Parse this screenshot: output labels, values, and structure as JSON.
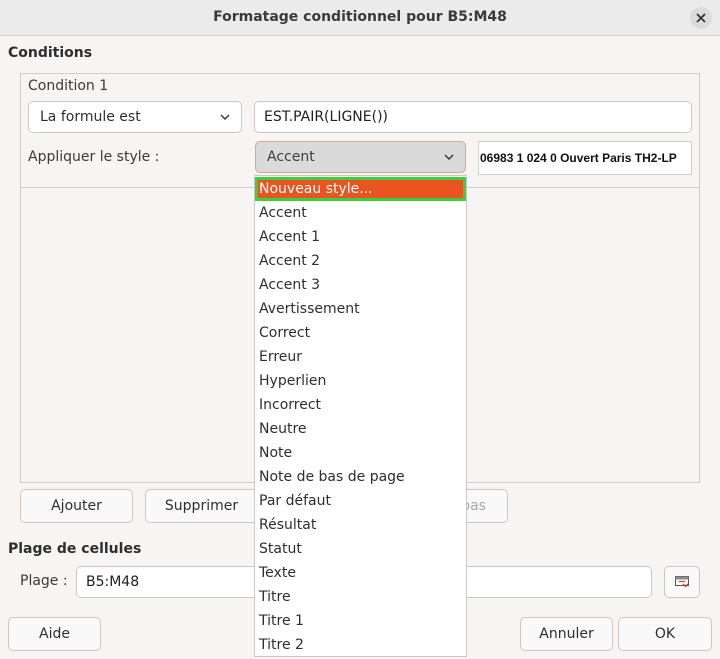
{
  "window": {
    "title": "Formatage conditionnel pour B5:M48"
  },
  "conditions": {
    "section_label": "Conditions",
    "condition_label": "Condition 1",
    "type_combo": {
      "value": "La formule est"
    },
    "formula_entry": {
      "value": "EST.PAIR(LIGNE())"
    },
    "apply_style_label": "Appliquer le style :",
    "style_combo": {
      "value": "Accent"
    },
    "preview_text": "06983 1 024 0  Ouvert Paris TH2-LP"
  },
  "style_dropdown": {
    "items": [
      "Nouveau style...",
      "Accent",
      "Accent 1",
      "Accent 2",
      "Accent 3",
      "Avertissement",
      "Correct",
      "Erreur",
      "Hyperlien",
      "Incorrect",
      "Neutre",
      "Note",
      "Note de bas de page",
      "Par défaut",
      "Résultat",
      "Statut",
      "Texte",
      "Titre",
      "Titre 1",
      "Titre 2"
    ],
    "selected_index": 0
  },
  "buttons": {
    "add": "Ajouter",
    "delete": "Supprimer",
    "down_partial": "bas",
    "help": "Aide",
    "cancel": "Annuler",
    "ok": "OK"
  },
  "range": {
    "section_label": "Plage de cellules",
    "label": "Plage :",
    "value": "B5:M48"
  },
  "colors": {
    "selection": "#e95420",
    "selection_outline": "#3ad13a"
  },
  "icons": {
    "close": "close-icon",
    "chevron": "chevron-down-icon",
    "range_picker": "shrink-range-icon"
  }
}
